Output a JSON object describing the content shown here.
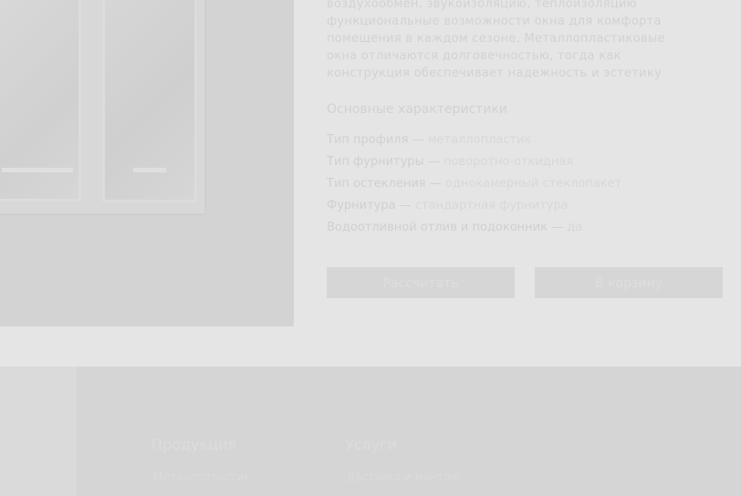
{
  "product": {
    "description_lines": [
      "воздухообмен, звукоизоляцию, теплоизоляцию",
      "функциональные возможности окна для комфорта",
      "помещения в каждом сезоне. Металлопластиковые",
      "окна отличаются долговечностью, тогда как",
      "конструкция обеспечивает надежность и эстетику"
    ],
    "characteristics_title": "Основные характеристики",
    "specs": [
      {
        "label": "Тип профиля",
        "value": "металлопластик"
      },
      {
        "label": "Тип фурнитуры",
        "value": "поворотно-откидная"
      },
      {
        "label": "Тип остекления",
        "value": "однокамерный стеклопакет"
      },
      {
        "label": "Фурнитура",
        "value": "стандартная фурнитура"
      },
      {
        "label": "Водоотливной отлив и подоконник",
        "value": "да"
      }
    ],
    "buttons": {
      "primary": "Рассчитать",
      "secondary": "В корзину"
    }
  },
  "footer": {
    "columns": [
      {
        "title": "Продукция",
        "link": "Металлопластик"
      },
      {
        "title": "Услуги",
        "link": "Доставка и монтаж"
      }
    ]
  }
}
